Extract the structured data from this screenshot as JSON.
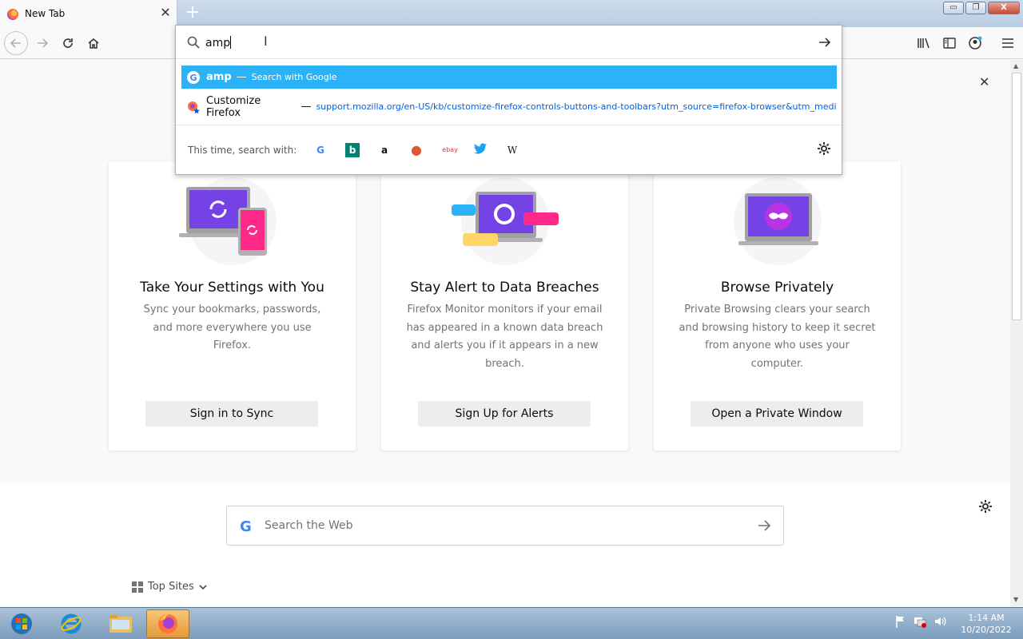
{
  "browser": {
    "tab_title": "New Tab",
    "new_tab_symbol": "+",
    "window_buttons": [
      "▭",
      "❐",
      "X"
    ]
  },
  "urlbar": {
    "typed_text": "amp",
    "results": [
      {
        "main": "amp",
        "separator": "—",
        "action": "Search with Google",
        "icon": "google-icon"
      },
      {
        "main": "Customize Firefox",
        "separator": "—",
        "url": "support.mozilla.org/en-US/kb/customize-firefox-controls-buttons-and-toolbars?utm_source=firefox-browser&utm_medium",
        "icon": "firefox-support-icon"
      }
    ],
    "oneoff_label": "This time, search with:",
    "engines": [
      {
        "name": "google",
        "glyph": "G",
        "color": "#4285f4"
      },
      {
        "name": "bing",
        "glyph": "b",
        "color": "#008373"
      },
      {
        "name": "amazon",
        "glyph": "a",
        "color": "#111111"
      },
      {
        "name": "duckduckgo",
        "glyph": "●",
        "color": "#de5833"
      },
      {
        "name": "ebay",
        "glyph": "ebay",
        "color": "#e53238"
      },
      {
        "name": "twitter",
        "glyph": "🐦",
        "color": "#1da1f2"
      },
      {
        "name": "wikipedia",
        "glyph": "W",
        "color": "#111111"
      }
    ]
  },
  "cards": [
    {
      "title": "Take Your Settings with You",
      "body": "Sync your bookmarks, passwords, and more everywhere you use Firefox.",
      "button": "Sign in to Sync"
    },
    {
      "title": "Stay Alert to Data Breaches",
      "body": "Firefox Monitor monitors if your email has appeared in a known data breach and alerts you if it appears in a new breach.",
      "button": "Sign Up for Alerts"
    },
    {
      "title": "Browse Privately",
      "body": "Private Browsing clears your search and browsing history to keep it secret from anyone who uses your computer.",
      "button": "Open a Private Window"
    }
  ],
  "search": {
    "placeholder": "Search the Web",
    "google_glyph": "G"
  },
  "topsites": {
    "label": "Top Sites"
  },
  "taskbar": {
    "time": "1:14 AM",
    "date": "10/20/2022"
  },
  "colors": {
    "accent": "#2cb2f6",
    "link": "#0060df",
    "card_art_purple": "#7542e5",
    "card_art_pink": "#ff298a"
  }
}
